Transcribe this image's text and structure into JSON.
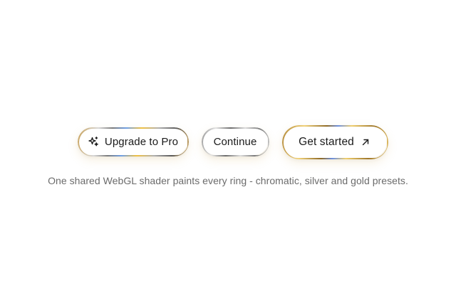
{
  "buttons": {
    "upgrade": {
      "label": "Upgrade to Pro",
      "icon": "sparkles-icon",
      "ring": "chromatic"
    },
    "continue": {
      "label": "Continue",
      "ring": "silver"
    },
    "get_started": {
      "label": "Get started",
      "icon": "arrow-up-right-icon",
      "ring": "gold"
    }
  },
  "caption": "One shared WebGL shader paints every ring - chromatic, silver and gold presets.",
  "colors": {
    "background": "#ffffff",
    "text": "#1a1a1a",
    "caption": "#6b6b6b",
    "gold": "#d6b25e",
    "silver": "#bdbdbd"
  }
}
